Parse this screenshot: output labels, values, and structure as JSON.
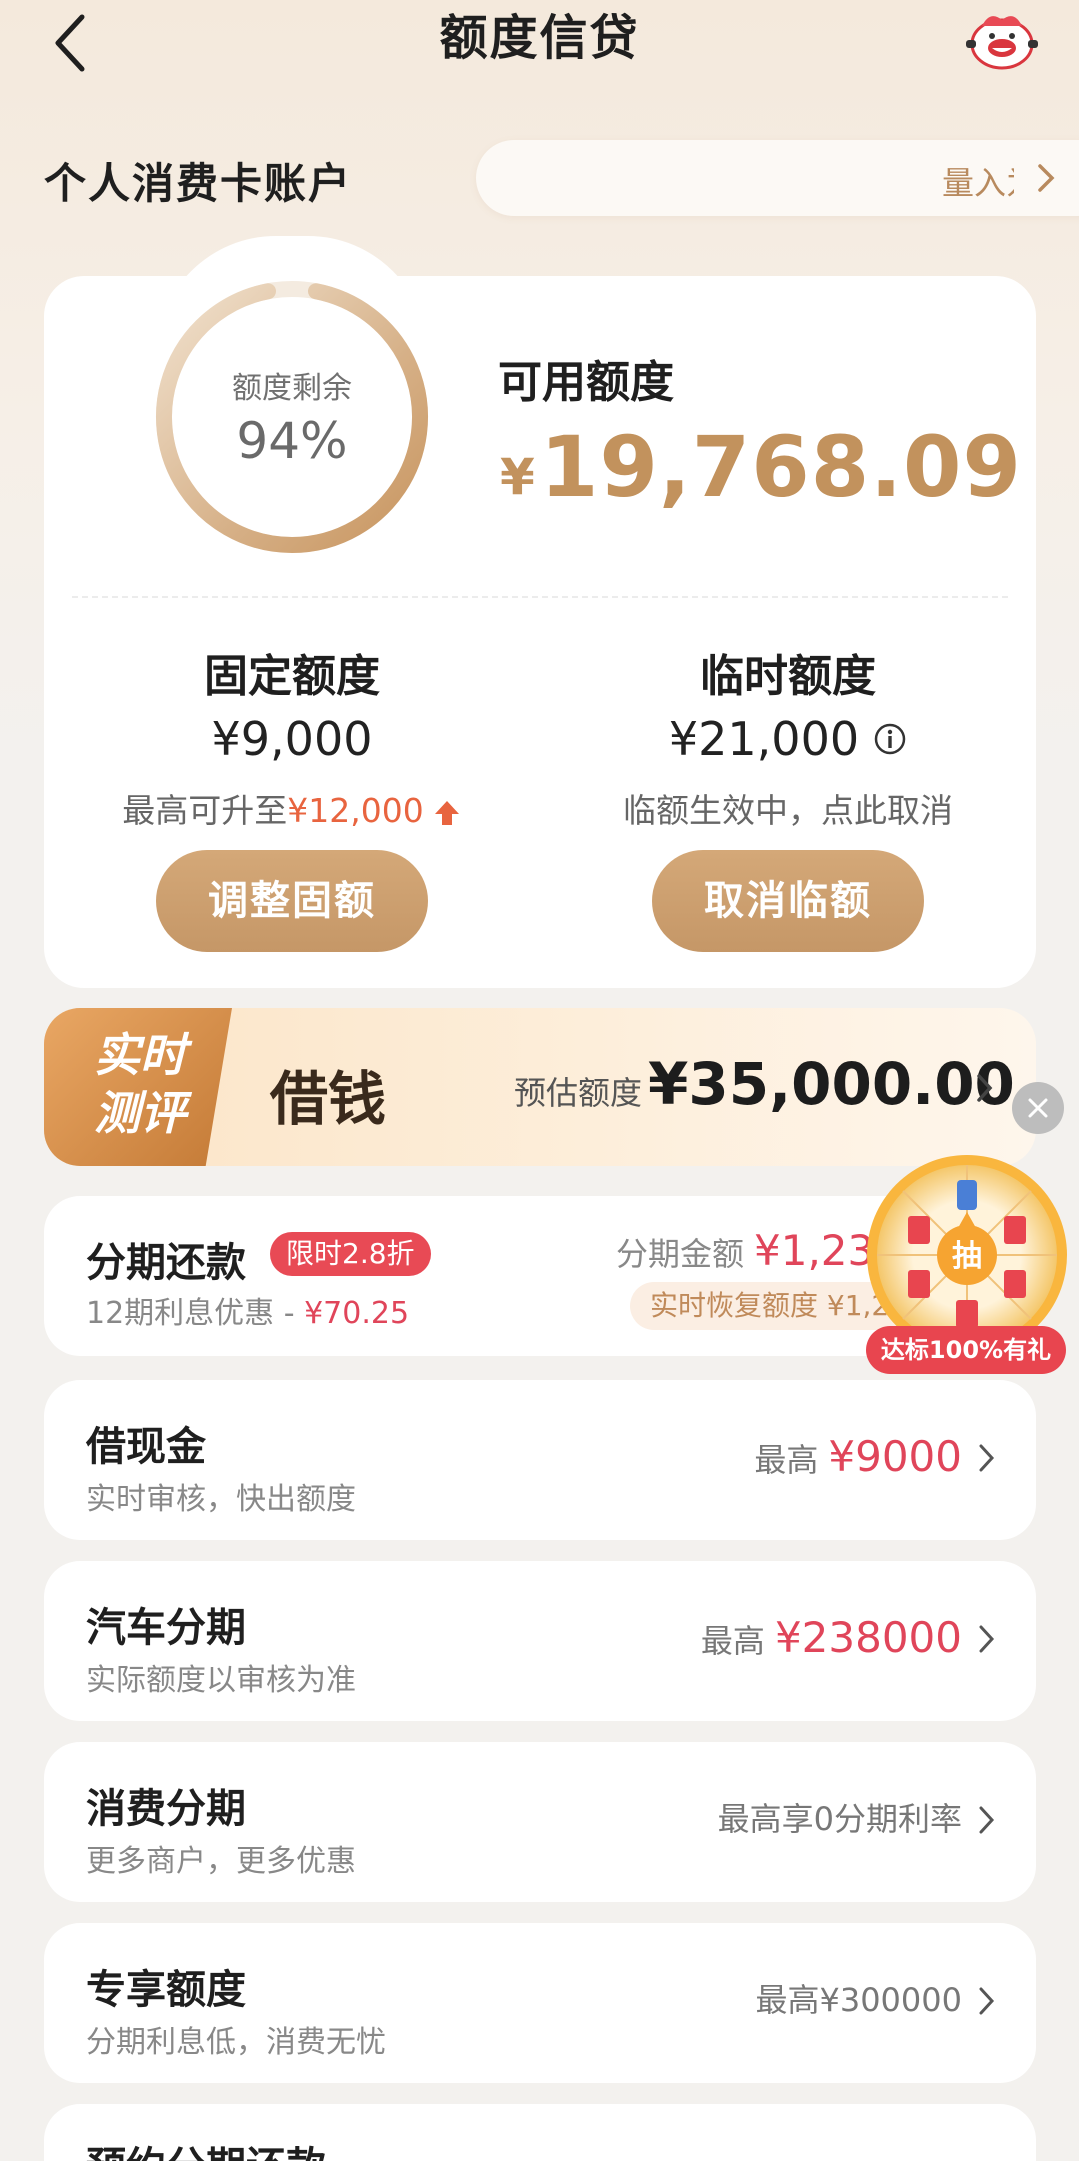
{
  "nav": {
    "title": "额度信贷"
  },
  "account": {
    "label": "个人消费卡账户",
    "pill_text": "量入为出"
  },
  "credit": {
    "ring_label": "额度剩余",
    "ring_percent": "94%",
    "ring_fraction": 0.94,
    "available_label": "可用额度",
    "available_currency": "¥",
    "available_value": "19,768.09",
    "fixed": {
      "title": "固定额度",
      "amount": "¥9,000",
      "sub_prefix": "最高可升至",
      "sub_amount": "¥12,000",
      "button": "调整固额"
    },
    "temp": {
      "title": "临时额度",
      "amount": "¥21,000",
      "sub": "临额生效中，点此取消",
      "button": "取消临额"
    }
  },
  "banner": {
    "badge_line1": "实时",
    "badge_line2": "测评",
    "title": "借钱",
    "est_label": "预估额度",
    "est_value": "¥35,000.00"
  },
  "installment": {
    "title": "分期还款",
    "tag": "限时2.8折",
    "sub_prefix": "12期利息优惠 -",
    "sub_amount": "¥70.25",
    "amount_label": "分期金额",
    "amount_value": "¥1,23",
    "restore": "实时恢复额度 ¥1,2"
  },
  "items": [
    {
      "title": "借现金",
      "sub": "实时审核，快出额度",
      "right_label": "最高",
      "right_amount": "¥9000"
    },
    {
      "title": "汽车分期",
      "sub": "实际额度以审核为准",
      "right_label": "最高",
      "right_amount": "¥238000"
    },
    {
      "title": "消费分期",
      "sub": "更多商户，更多优惠",
      "right_label": "最高享0分期利率",
      "right_amount": ""
    },
    {
      "title": "专享额度",
      "sub": "分期利息低，消费无忧",
      "right_label": "最高¥300000",
      "right_amount": ""
    },
    {
      "title": "预约分期还款",
      "sub": "",
      "right_label": "",
      "right_amount": ""
    }
  ],
  "wheel": {
    "center": "抽",
    "tag": "达标100%有礼"
  },
  "colors": {
    "gold": "#c2925d",
    "red": "#e0455a",
    "tag_red": "#e84a55",
    "orange": "#e8643f"
  }
}
